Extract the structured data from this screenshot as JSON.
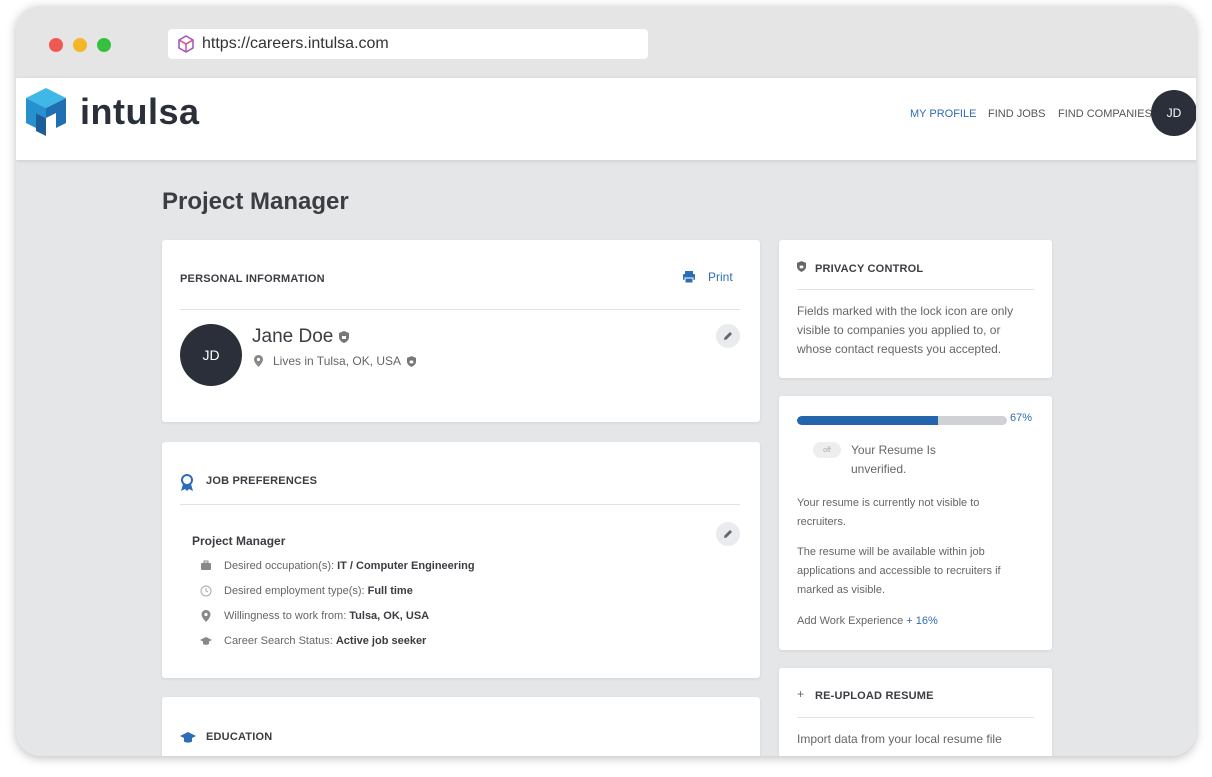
{
  "browser": {
    "url": "https://careers.intulsa.com"
  },
  "header": {
    "brand": "intulsa",
    "nav": [
      {
        "label": "MY PROFILE",
        "active": true
      },
      {
        "label": "FIND JOBS",
        "active": false
      },
      {
        "label": "FIND COMPANIES",
        "active": false
      }
    ],
    "avatar_initials": "JD"
  },
  "page": {
    "title": "Project Manager"
  },
  "personal_info": {
    "title": "PERSONAL INFORMATION",
    "print_label": "Print",
    "avatar_initials": "JD",
    "name": "Jane  Doe",
    "location": "Lives in Tulsa, OK, USA"
  },
  "job_preferences": {
    "title": "JOB PREFERENCES",
    "role": "Project Manager",
    "rows": [
      {
        "label": "Desired occupation(s):",
        "value": "IT / Computer Engineering",
        "icon": "briefcase-icon"
      },
      {
        "label": "Desired employment type(s):",
        "value": "Full time",
        "icon": "clock-icon"
      },
      {
        "label": "Willingness to work from:",
        "value": "Tulsa, OK, USA",
        "icon": "pin-icon"
      },
      {
        "label": "Career Search Status:",
        "value": "Active job seeker",
        "icon": "graduation-cap-icon"
      }
    ]
  },
  "education": {
    "title": "EDUCATION"
  },
  "privacy": {
    "title": "PRIVACY CONTROL",
    "text": "Fields marked with the lock icon are only visible to companies you applied to, or whose contact requests you accepted."
  },
  "resume_status": {
    "progress_percent": 67,
    "progress_label": "67%",
    "toggle_label": "off",
    "status_line1": "Your Resume Is",
    "status_line2": "unverified.",
    "visibility_text": "Your resume is currently not visible to recruiters.",
    "availability_text": "The resume will be available within job applications and accessible to recruiters if marked as visible.",
    "suggestion_text": "Add Work Experience",
    "suggestion_bonus": "+ 16%"
  },
  "reupload": {
    "title": "RE-UPLOAD RESUME",
    "text": "Import data from your local resume file"
  },
  "colors": {
    "accent": "#2d6db5",
    "progress": "#2565ad",
    "dark": "#2a2f3a",
    "logo_light": "#3fb8e8",
    "logo_dark": "#1f6fb2"
  }
}
